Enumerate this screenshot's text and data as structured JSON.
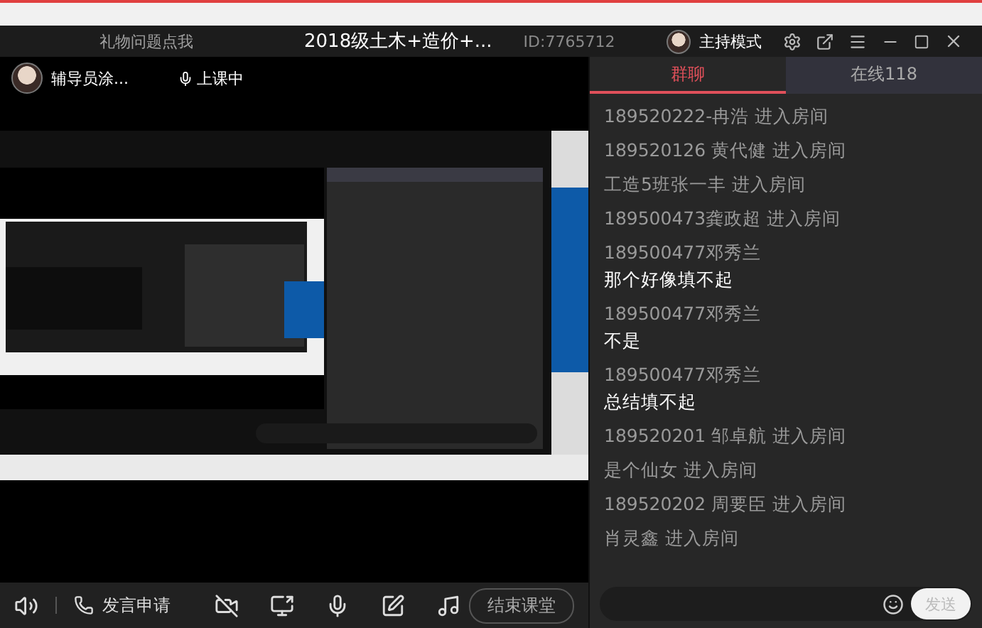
{
  "title_bar": {
    "gift_link": "礼物问题点我",
    "title": "2018级土木+造价+...",
    "room_id": "ID:7765712",
    "mode": "主持模式"
  },
  "host": {
    "name": "辅导员涂...",
    "status": "上课中"
  },
  "toolbar": {
    "apply_speak": "发言申请",
    "end_class": "结束课堂",
    "tools": [
      {
        "kind": "camera-off"
      },
      {
        "kind": "share"
      },
      {
        "kind": "mic"
      },
      {
        "kind": "edit"
      },
      {
        "kind": "music"
      }
    ]
  },
  "chat": {
    "tabs": [
      {
        "label": "群聊",
        "selected": true
      },
      {
        "label": "在线118",
        "selected": false
      }
    ],
    "messages": [
      {
        "kind": "join",
        "sender": "189520222-冉浩 进入房间"
      },
      {
        "kind": "join",
        "sender": "189520126 黄代健 进入房间"
      },
      {
        "kind": "join",
        "sender": "工造5班张一丰 进入房间"
      },
      {
        "kind": "join",
        "sender": "189500473龚政超 进入房间"
      },
      {
        "kind": "message",
        "sender": "189500477邓秀兰",
        "text": "那个好像填不起"
      },
      {
        "kind": "message",
        "sender": "189500477邓秀兰",
        "text": "不是"
      },
      {
        "kind": "message",
        "sender": "189500477邓秀兰",
        "text": "总结填不起"
      },
      {
        "kind": "join",
        "sender": "189520201  邹卓航 进入房间"
      },
      {
        "kind": "join",
        "sender": "是个仙女 进入房间"
      },
      {
        "kind": "join",
        "sender": "189520202  周要臣 进入房间"
      },
      {
        "kind": "join",
        "sender": "肖灵鑫 进入房间"
      }
    ],
    "send": "发送"
  }
}
